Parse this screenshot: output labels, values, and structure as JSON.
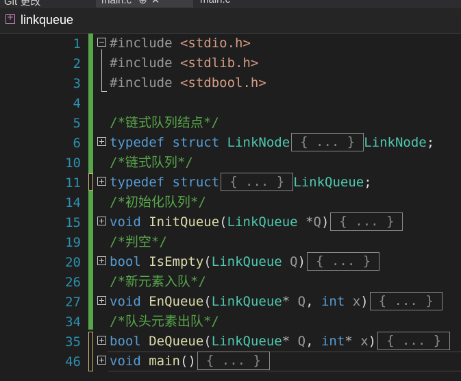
{
  "tabs": [
    {
      "label": "Git 更改",
      "active": false
    },
    {
      "label": "main.c",
      "active": true
    },
    {
      "label": "main.c",
      "active": false
    }
  ],
  "file": {
    "name": "linkqueue",
    "icon": "c-project-icon"
  },
  "line_numbers": [
    "1",
    "2",
    "3",
    "4",
    "5",
    "6",
    "10",
    "11",
    "14",
    "15",
    "19",
    "20",
    "26",
    "27",
    "34",
    "35",
    "46"
  ],
  "code": {
    "include_kw": "#include",
    "inc1": "<stdio.h>",
    "inc2": "<stdlib.h>",
    "inc3": "<stdbool.h>",
    "c1": "/*链式队列结点*/",
    "typedef": "typedef",
    "struct": "struct",
    "linknode": "LinkNode",
    "linknode_tail": "LinkNode",
    "c2": "/*链式队列*/",
    "linkqueue_tail": "LinkQueue",
    "c3": "/*初始化队列*/",
    "void": "void",
    "initqueue": "InitQueue",
    "linkqueue_t": "LinkQueue",
    "star": "*",
    "q": "Q",
    "c4": "/*判空*/",
    "bool": "bool",
    "isempty": "IsEmpty",
    "c5": "/*新元素入队*/",
    "enqueue": "EnQueue",
    "int": "int",
    "x": "x",
    "c6": "/*队头元素出队*/",
    "dequeue": "DeQueue",
    "main": "main",
    "collapsed": "{ ... }",
    "semicolon": ";",
    "lparen": "(",
    "rparen": ")",
    "comma": ","
  },
  "colors": {
    "background": "#1e1e1e",
    "keyword": "#569cd6",
    "type": "#4ec9b0",
    "function": "#dcdcaa",
    "comment": "#57a64a",
    "include_path": "#d69d85",
    "line_number": "#2b91af"
  }
}
